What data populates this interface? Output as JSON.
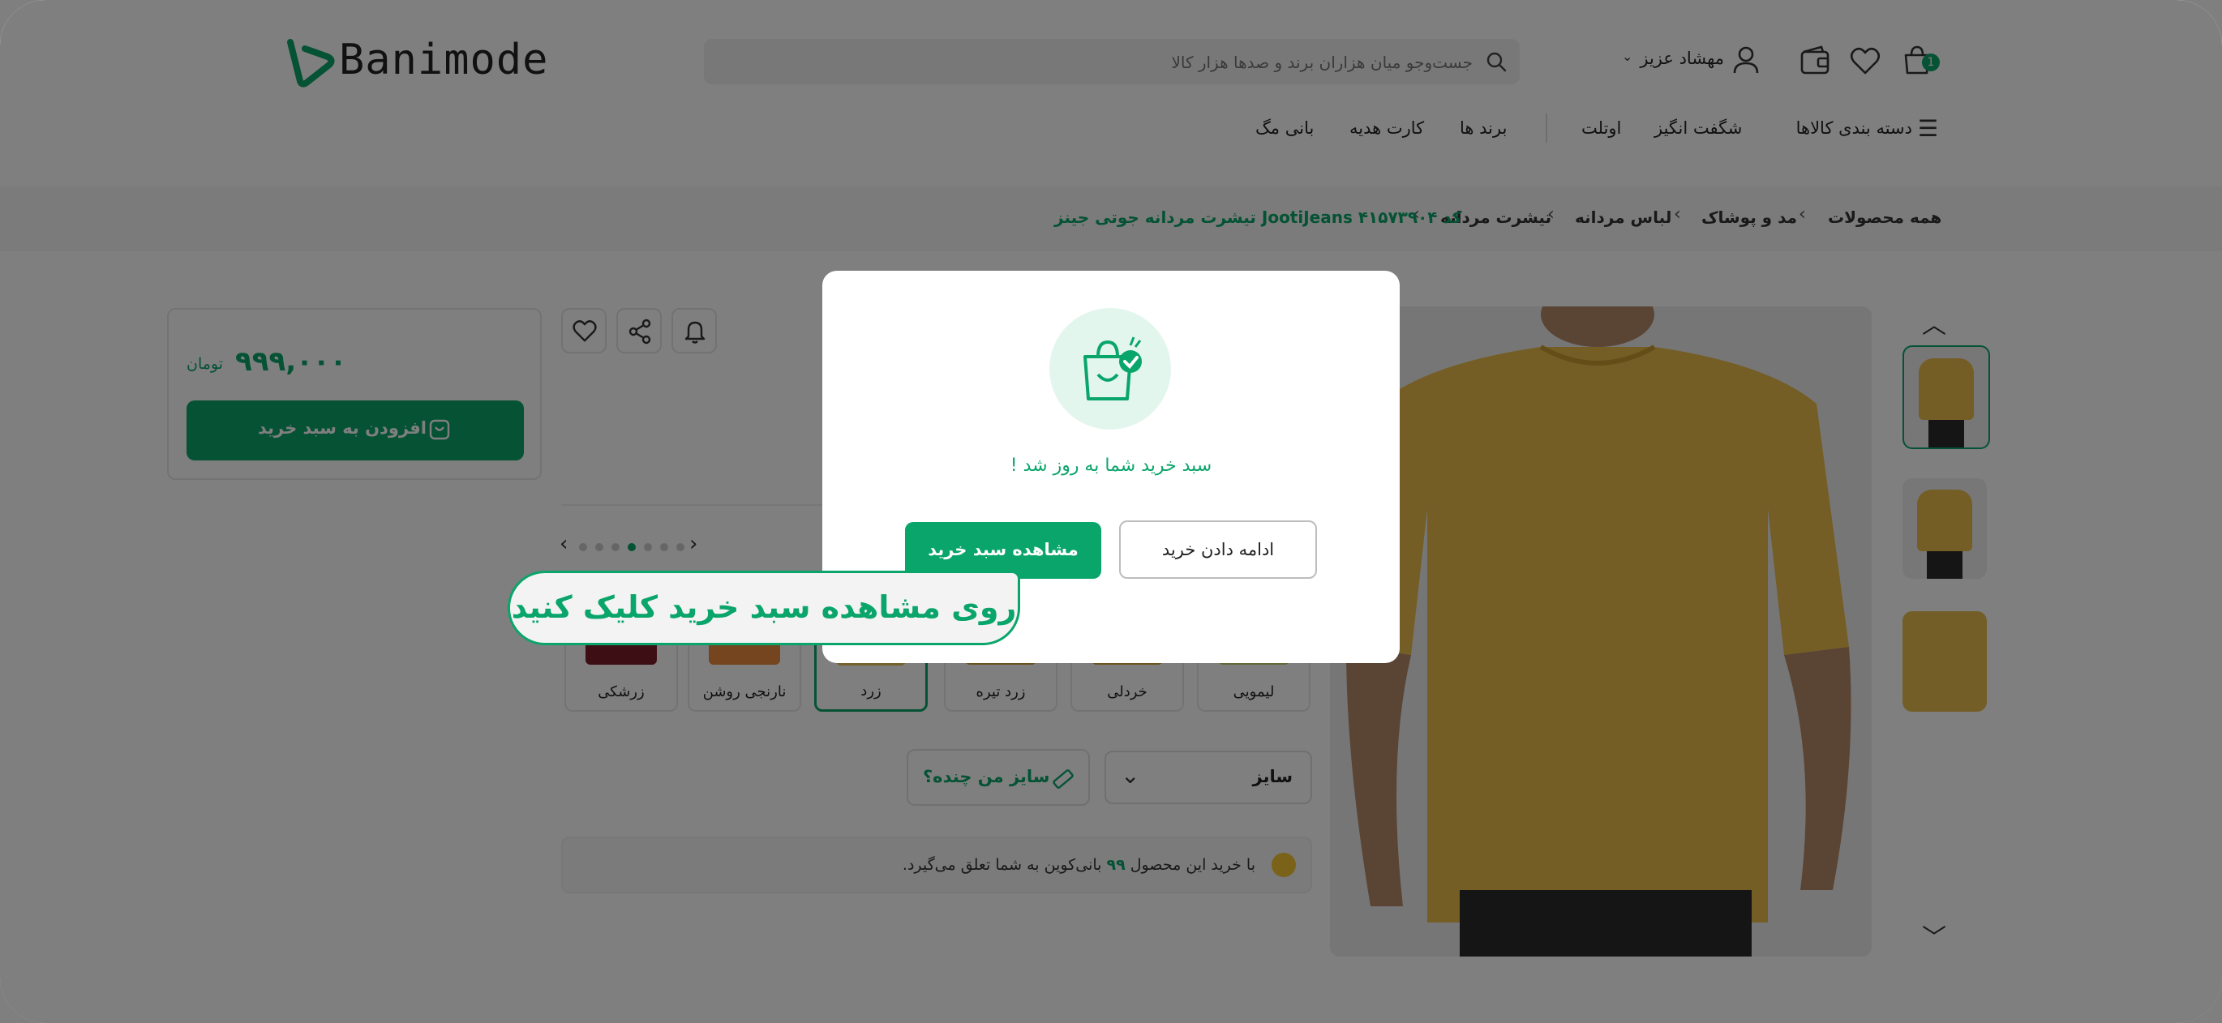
{
  "brand": {
    "logo_text": "Banimode",
    "accent": "#0aa56b"
  },
  "header": {
    "cart_count": "1",
    "account_label": "مهشاد عزیز",
    "search_placeholder": "جست‌وجو میان هزاران برند و صدها هزار کالا"
  },
  "nav": {
    "categories": "دسته بندی کالاها",
    "amazing": "شگفت انگیز",
    "outlet": "اوتلت",
    "brands": "برند ها",
    "gift_card": "کارت هدیه",
    "mag": "بانی مگ"
  },
  "breadcrumb": {
    "items": [
      "همه محصولات",
      "مد و پوشاک",
      "لباس مردانه",
      "تیشرت مردانه"
    ],
    "current": "تیشرت مردانه جوتی جینز JootiJeans کد ۴۱۵۷۳۹۰۴"
  },
  "price": {
    "amount": "۹۹۹,۰۰۰",
    "currency": "تومان",
    "add_to_cart": "افزودن به سبد خرید"
  },
  "colors": [
    {
      "label": "لیمویی",
      "color": "#cbd36a"
    },
    {
      "label": "خردلی",
      "color": "#d7a93a"
    },
    {
      "label": "زرد تیره",
      "color": "#d0a43d"
    },
    {
      "label": "زرد",
      "color": "#e8c75a"
    },
    {
      "label": "نارنجی روشن",
      "color": "#e88a3c"
    },
    {
      "label": "زرشکی",
      "color": "#7a1f2b"
    }
  ],
  "size": {
    "select_label": "سایز",
    "guide": "سایز من چنده؟"
  },
  "points": {
    "pre": "با خرید این محصول",
    "value": "۹۹",
    "post": "بانی‌کوین به شما تعلق می‌گیرد."
  },
  "modal": {
    "message": "سبد خرید شما به روز شد !",
    "view_cart": "مشاهده سبد خرید",
    "continue": "ادامه دادن خرید"
  },
  "tooltip": {
    "text": "روی مشاهده سبد خرید کلیک کنید"
  }
}
